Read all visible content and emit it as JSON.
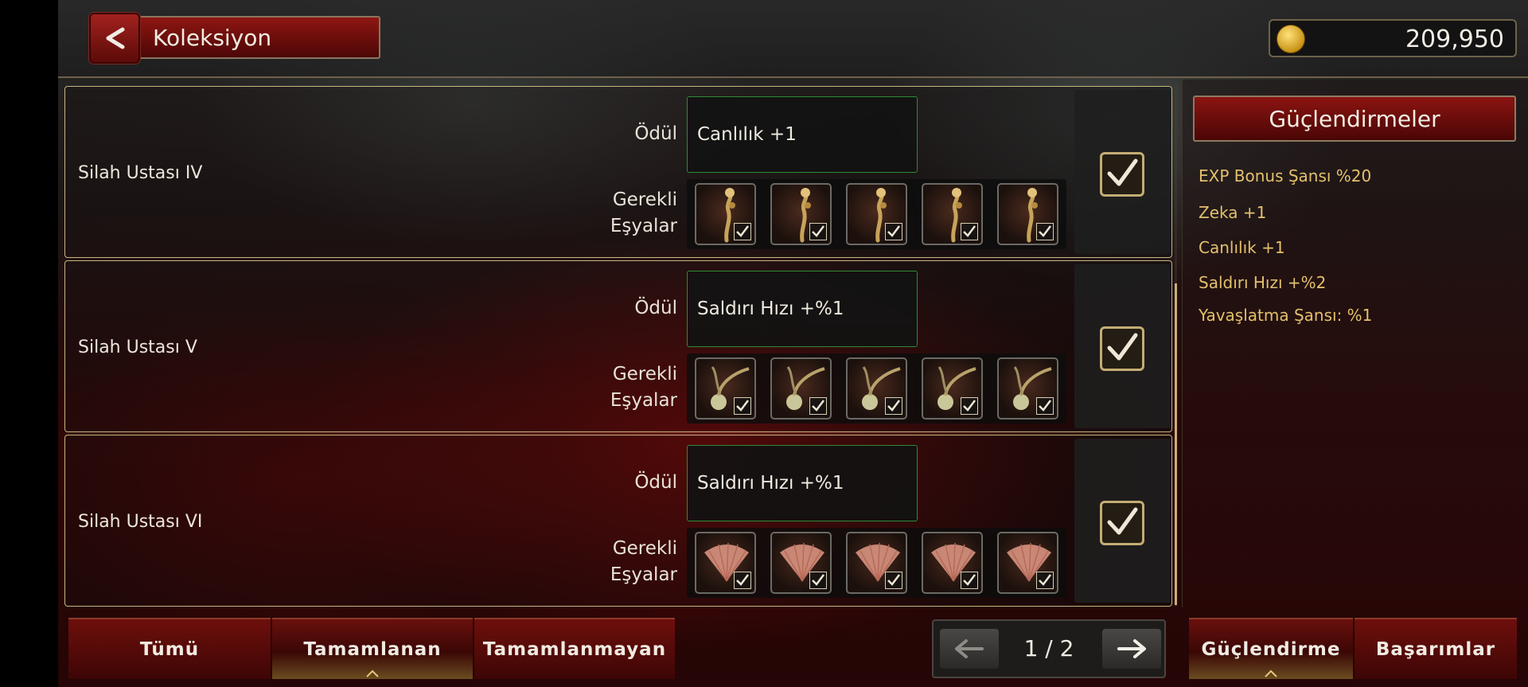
{
  "header": {
    "title": "Koleksiyon",
    "gold": "209,950"
  },
  "labels": {
    "reward": "Ödül",
    "required_line1": "Gerekli",
    "required_line2": "Eşyalar"
  },
  "collections": [
    {
      "name": "Silah Ustası IV",
      "reward": "Canlılık +1",
      "item_type": "staff",
      "completed": true
    },
    {
      "name": "Silah Ustası V",
      "reward": "Saldırı Hızı +%1",
      "item_type": "wand",
      "completed": true
    },
    {
      "name": "Silah Ustası VI",
      "reward": "Saldırı Hızı +%1",
      "item_type": "fan",
      "completed": true
    }
  ],
  "side_panel": {
    "title": "Güçlendirmeler",
    "buffs": [
      "EXP Bonus Şansı %20",
      "Zeka +1",
      "Canlılık +1",
      "Saldırı Hızı +%2",
      "Yavaşlatma Şansı: %1"
    ]
  },
  "tabs": [
    {
      "label": "Tümü",
      "active": false
    },
    {
      "label": "Tamamlanan",
      "active": true
    },
    {
      "label": "Tamamlanmayan",
      "active": false
    }
  ],
  "pager": {
    "text": "1 / 2"
  },
  "side_tabs": [
    {
      "label": "Güçlendirme",
      "active": true
    },
    {
      "label": "Başarımlar",
      "active": false
    }
  ],
  "colors": {
    "accent_red": "#8b1411",
    "gold_text": "#e3c06d",
    "reward_border": "#2f8a37",
    "frame_gold": "#c7b582"
  },
  "icons": [
    "back-arrow-icon",
    "gold-coin-icon",
    "checkmark-icon",
    "left-arrow-icon",
    "right-arrow-icon"
  ]
}
